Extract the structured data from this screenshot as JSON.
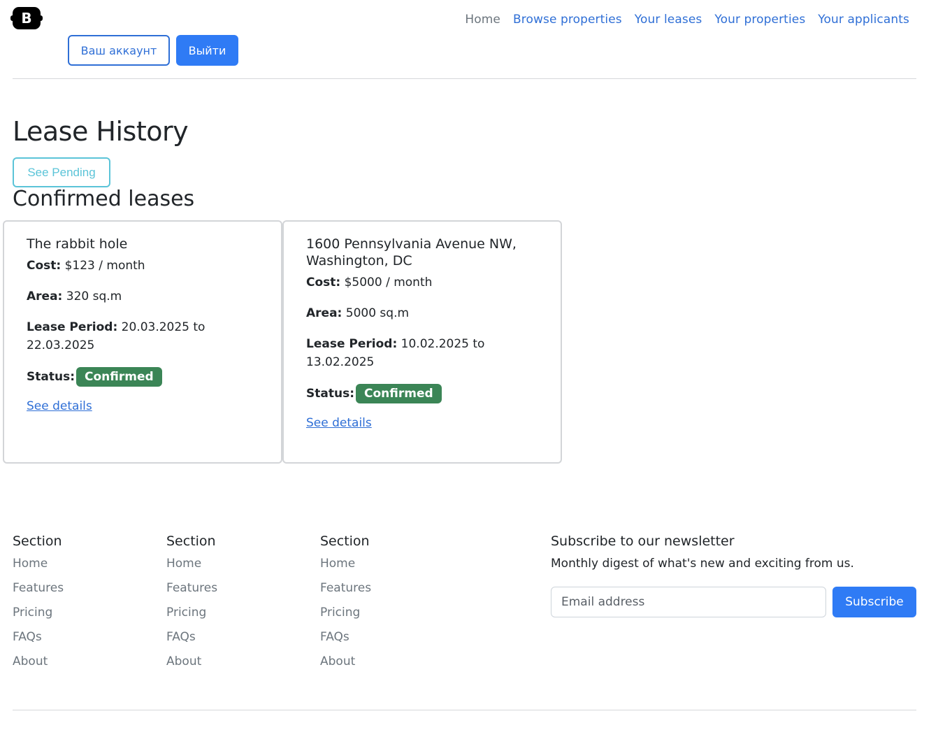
{
  "brand": {
    "logo_letter": "B"
  },
  "nav": {
    "items": [
      {
        "label": "Home"
      },
      {
        "label": "Browse properties"
      },
      {
        "label": "Your leases"
      },
      {
        "label": "Your properties"
      },
      {
        "label": "Your applicants"
      }
    ]
  },
  "auth": {
    "account_label": "Ваш аккаунт",
    "logout_label": "Выйти"
  },
  "page": {
    "title": "Lease History",
    "pending_button": "See Pending",
    "section_title": "Confirmed leases"
  },
  "labels": {
    "cost": "Cost:",
    "area": "Area:",
    "period": "Lease Period:",
    "status": "Status:",
    "details_link": "See details"
  },
  "leases": [
    {
      "title": "The rabbit hole",
      "cost": "$123 / month",
      "area": "320 sq.m",
      "period": "20.03.2025 to 22.03.2025",
      "status": "Confirmed"
    },
    {
      "title": "1600 Pennsylvania Avenue NW, Washington, DC",
      "cost": "$5000 / month",
      "area": "5000 sq.m",
      "period": "10.02.2025 to 13.02.2025",
      "status": "Confirmed"
    }
  ],
  "footer": {
    "columns": [
      {
        "heading": "Section",
        "links": [
          "Home",
          "Features",
          "Pricing",
          "FAQs",
          "About"
        ]
      },
      {
        "heading": "Section",
        "links": [
          "Home",
          "Features",
          "Pricing",
          "FAQs",
          "About"
        ]
      },
      {
        "heading": "Section",
        "links": [
          "Home",
          "Features",
          "Pricing",
          "FAQs",
          "About"
        ]
      }
    ],
    "newsletter": {
      "heading": "Subscribe to our newsletter",
      "description": "Monthly digest of what's new and exciting from us.",
      "placeholder": "Email address",
      "button": "Subscribe"
    }
  },
  "colors": {
    "primary": "#2f7bf5",
    "link": "#2f6fd6",
    "info": "#5bc4d8",
    "success": "#3b8556",
    "muted": "#6c757d"
  }
}
